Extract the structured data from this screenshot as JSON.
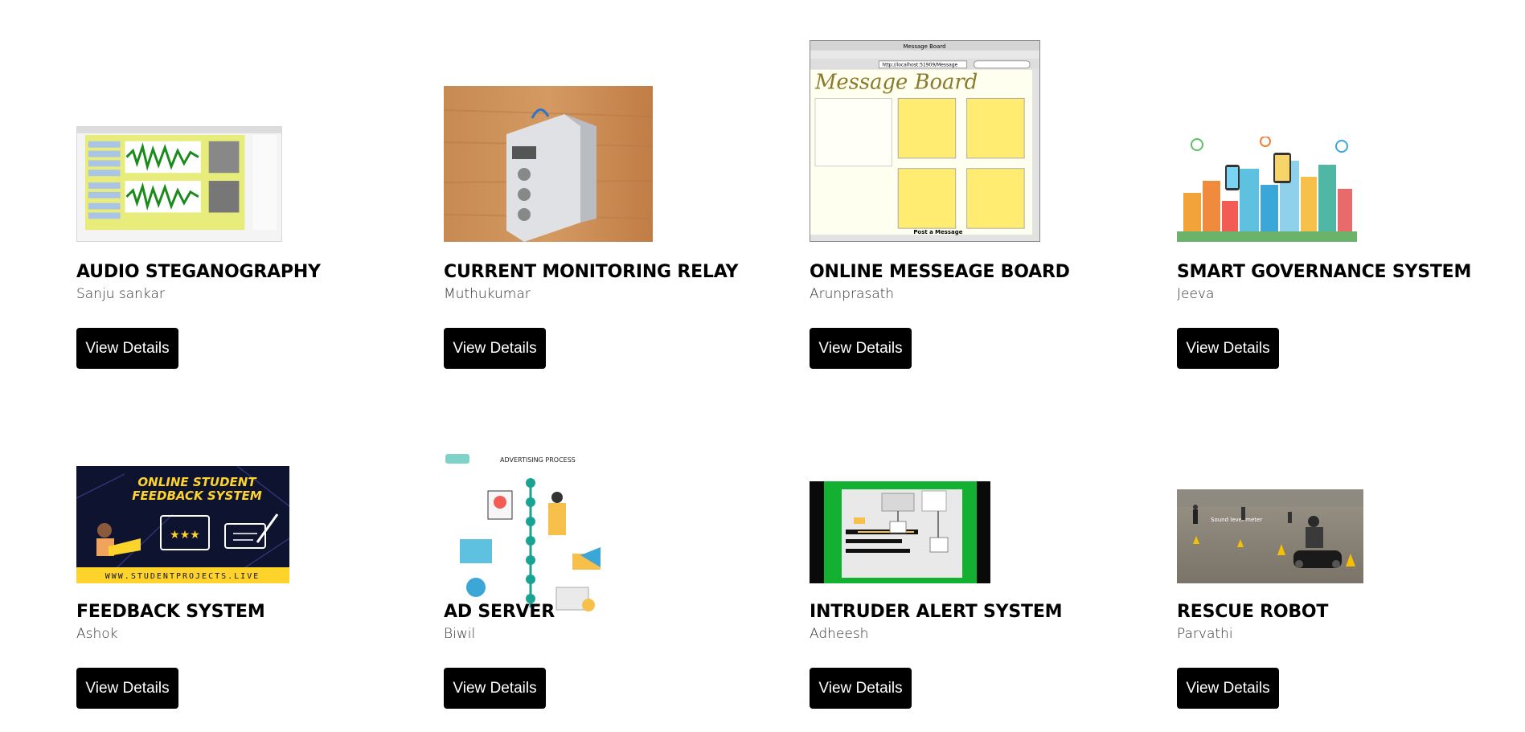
{
  "projects": [
    {
      "title": "AUDIO STEGANOGRAPHY",
      "author": "Sanju sankar",
      "button": "View Details",
      "image": "audio-steganography-screenshot"
    },
    {
      "title": "CURRENT MONITORING RELAY",
      "author": "Muthukumar",
      "button": "View Details",
      "image": "relay-device-photo"
    },
    {
      "title": "ONLINE MESSEAGE BOARD",
      "author": "Arunprasath",
      "button": "View Details",
      "image": "message-board-screenshot",
      "image_text": {
        "window_title": "Message Board",
        "heading": "Message Board",
        "url": "http://localhost:51909/Message",
        "post_button": "Post a Message"
      }
    },
    {
      "title": "SMART GOVERNANCE SYSTEM",
      "author": "Jeeva",
      "button": "View Details",
      "image": "smart-city-illustration"
    },
    {
      "title": "FEEDBACK SYSTEM",
      "author": "Ashok",
      "button": "View Details",
      "image": "feedback-system-banner",
      "image_text": {
        "line1": "ONLINE STUDENT",
        "line2": "FEEDBACK SYSTEM",
        "footer": "WWW.STUDENTPROJECTS.LIVE"
      }
    },
    {
      "title": "AD SERVER",
      "author": "Biwil",
      "button": "View Details",
      "image": "advertising-process-infographic",
      "image_text": {
        "heading": "ADVERTISING PROCESS"
      }
    },
    {
      "title": "INTRUDER ALERT SYSTEM",
      "author": "Adheesh",
      "button": "View Details",
      "image": "intruder-alert-hardware-photo"
    },
    {
      "title": "RESCUE ROBOT",
      "author": "Parvathi",
      "button": "View Details",
      "image": "rescue-robot-photo",
      "image_text": {
        "label": "Sound level meter"
      }
    }
  ]
}
